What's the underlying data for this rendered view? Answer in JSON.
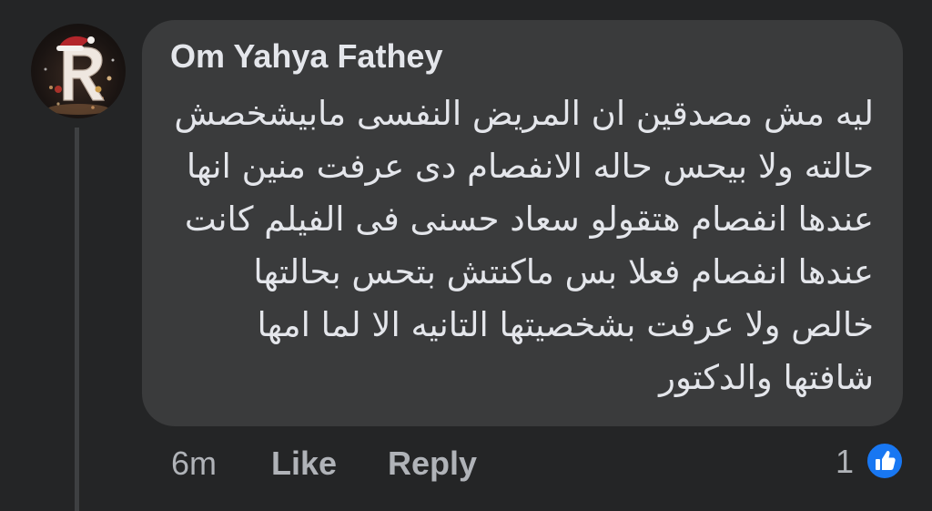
{
  "comment": {
    "author": "Om Yahya Fathey",
    "lines": [
      "ليه مش مصدقين ان المريض النفسى مابيشخصش",
      "حالته ولا بيحس حاله الانفصام دى عرفت منين انها",
      "عندها انفصام هتقولو سعاد حسنى فى الفيلم كانت",
      "عندها انفصام فعلا بس ماكنتش بتحس بحالتها",
      "خالص ولا عرفت بشخصيتها التانيه الا لما امها",
      "شافتها والدكتور"
    ],
    "avatar_letter": "R"
  },
  "actions": {
    "time": "6m",
    "like_label": "Like",
    "reply_label": "Reply"
  },
  "reactions": {
    "count": "1",
    "icon": "thumbs-up-icon"
  },
  "colors": {
    "background": "#242526",
    "bubble": "#3a3b3c",
    "text_primary": "#e4e6eb",
    "text_secondary": "#b0b3b8",
    "like_blue": "#1877f2"
  }
}
